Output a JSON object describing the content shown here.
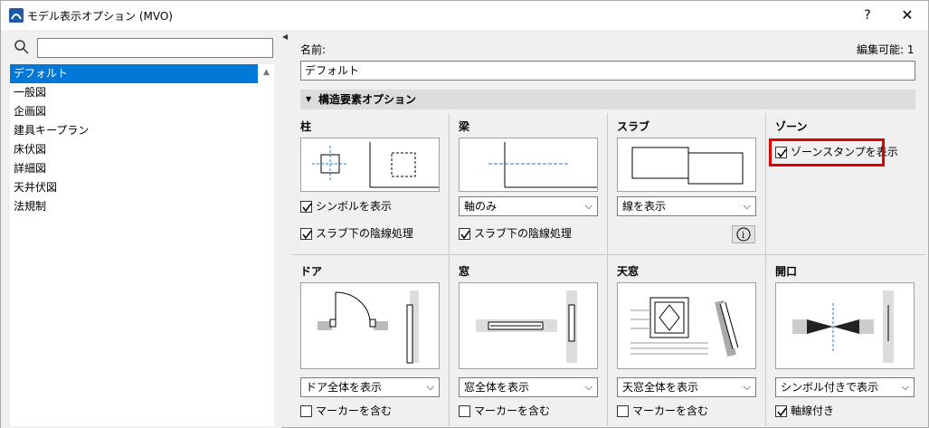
{
  "window": {
    "title": "モデル表示オプション (MVO)",
    "help": "?",
    "close": "✕"
  },
  "sidebar": {
    "search_placeholder": "",
    "items": [
      {
        "label": "デフォルト"
      },
      {
        "label": "一般図"
      },
      {
        "label": "企画図"
      },
      {
        "label": "建具キープラン"
      },
      {
        "label": "床伏図"
      },
      {
        "label": "詳細図"
      },
      {
        "label": "天井伏図"
      },
      {
        "label": "法規制"
      }
    ]
  },
  "main": {
    "name_label": "名前:",
    "editable_label": "編集可能: 1",
    "name_value": "デフォルト",
    "section_title": "構造要素オプション",
    "column": {
      "title": "柱",
      "chk1": "シンボルを表示",
      "chk2": "スラブ下の陰線処理"
    },
    "beam": {
      "title": "梁",
      "select": "軸のみ",
      "chk": "スラブ下の陰線処理"
    },
    "slab": {
      "title": "スラブ",
      "select": "線を表示"
    },
    "zone": {
      "title": "ゾーン",
      "chk": "ゾーンスタンプを表示"
    },
    "door": {
      "title": "ドア",
      "select": "ドア全体を表示",
      "chk": "マーカーを含む"
    },
    "window": {
      "title": "窓",
      "select": "窓全体を表示",
      "chk": "マーカーを含む"
    },
    "skylight": {
      "title": "天窓",
      "select": "天窓全体を表示",
      "chk": "マーカーを含む"
    },
    "opening": {
      "title": "開口",
      "select": "シンボル付きで表示",
      "chk": "軸線付き"
    }
  },
  "colors": {
    "selection": "#0078d7",
    "highlight": "#e00000"
  }
}
